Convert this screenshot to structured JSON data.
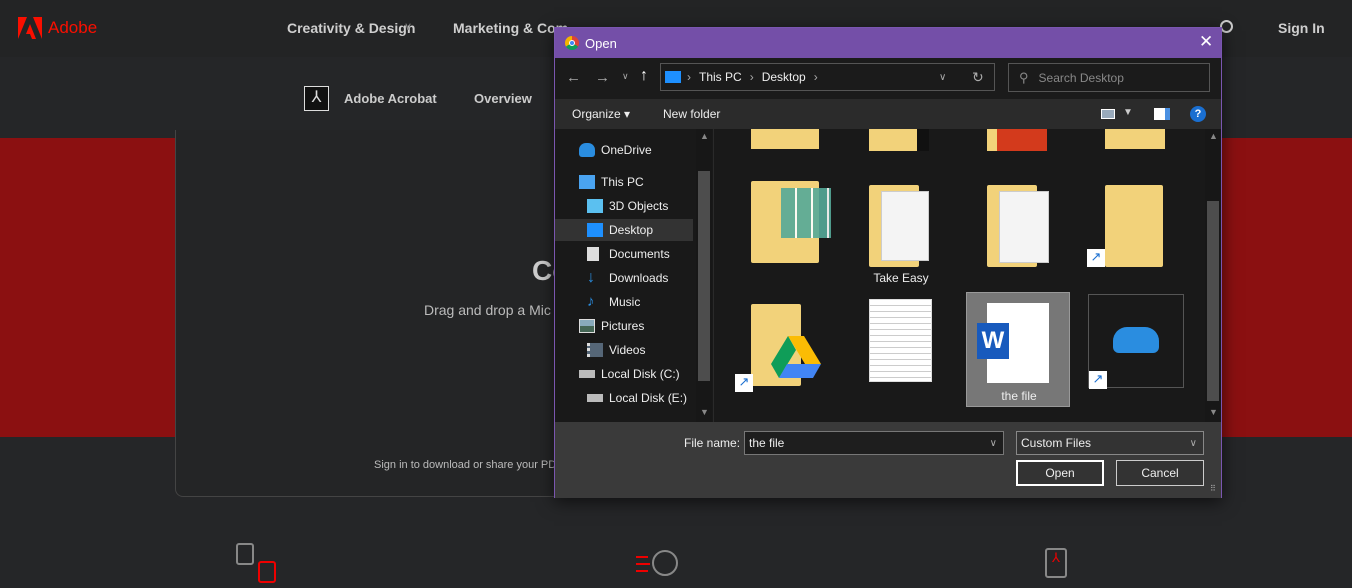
{
  "site": {
    "logo": "Adobe",
    "nav": [
      "Creativity & Design",
      "Marketing & Com"
    ],
    "sign_in": "Sign In",
    "product": "Adobe Acrobat",
    "overview": "Overview",
    "heading_fragment": "Co",
    "drag_text": "Drag and drop a Mic",
    "signin_text": "Sign in to download or share your PD",
    "brand_color": "#fa0f00",
    "band_color": "#8b1011"
  },
  "dialog": {
    "title": "Open",
    "path": [
      "This PC",
      "Desktop"
    ],
    "search_placeholder": "Search Desktop",
    "organize": "Organize",
    "new_folder": "New folder",
    "nav_items": [
      {
        "label": "OneDrive",
        "icon": "onedrive-icon"
      },
      {
        "label": "This PC",
        "icon": "computer-icon"
      },
      {
        "label": "3D Objects",
        "icon": "cube-icon"
      },
      {
        "label": "Desktop",
        "icon": "desktop-icon",
        "selected": true
      },
      {
        "label": "Documents",
        "icon": "document-icon"
      },
      {
        "label": "Downloads",
        "icon": "download-icon"
      },
      {
        "label": "Music",
        "icon": "music-icon"
      },
      {
        "label": "Pictures",
        "icon": "pictures-icon"
      },
      {
        "label": "Videos",
        "icon": "video-icon"
      },
      {
        "label": "Local Disk (C:)",
        "icon": "drive-icon"
      },
      {
        "label": "Local Disk (E:)",
        "icon": "drive-icon"
      }
    ],
    "files": [
      {
        "label": "Take Easy",
        "type": "folder"
      },
      {
        "label": "the file",
        "type": "word-document",
        "selected": true
      }
    ],
    "file_name_label": "File name:",
    "file_name_value": "the file",
    "file_type": "Custom Files",
    "open": "Open",
    "cancel": "Cancel",
    "title_color": "#744fa8"
  }
}
